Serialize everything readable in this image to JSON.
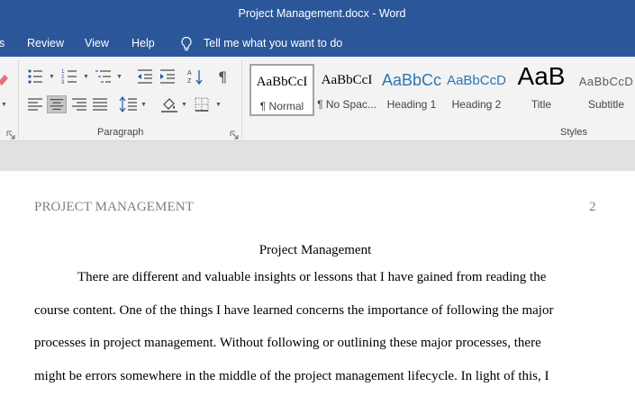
{
  "window": {
    "title": "Project Management.docx  -  Word"
  },
  "menu": {
    "items": [
      {
        "label": "s"
      },
      {
        "label": "Review"
      },
      {
        "label": "View"
      },
      {
        "label": "Help"
      }
    ],
    "tell_me": "Tell me what you want to do"
  },
  "ribbon": {
    "paragraph_group": {
      "label": "Paragraph"
    },
    "styles_group": {
      "label": "Styles",
      "items": [
        {
          "preview": "AaBbCcI",
          "name": "¶ Normal",
          "selected": true
        },
        {
          "preview": "AaBbCcI",
          "name": "¶ No Spac..."
        },
        {
          "preview": "AaBbCc",
          "name": "Heading 1",
          "color": "#2e74b5"
        },
        {
          "preview": "AaBbCcD",
          "name": "Heading 2",
          "color": "#2e74b5"
        },
        {
          "preview": "AaB",
          "name": "Title"
        },
        {
          "preview": "AaBbCcD",
          "name": "Subtitle",
          "color": "#5a5a5a"
        }
      ]
    }
  },
  "document": {
    "header": "PROJECT MANAGEMENT",
    "page_number": "2",
    "title": "Project Management",
    "lines": [
      "There are different and valuable insights or lessons that I have gained from reading the",
      "course content. One of the things I have learned concerns the importance of following the major",
      "processes in project management. Without following or outlining these major processes, there",
      "might be errors somewhere in the middle of the project management lifecycle. In light of this, I"
    ]
  }
}
